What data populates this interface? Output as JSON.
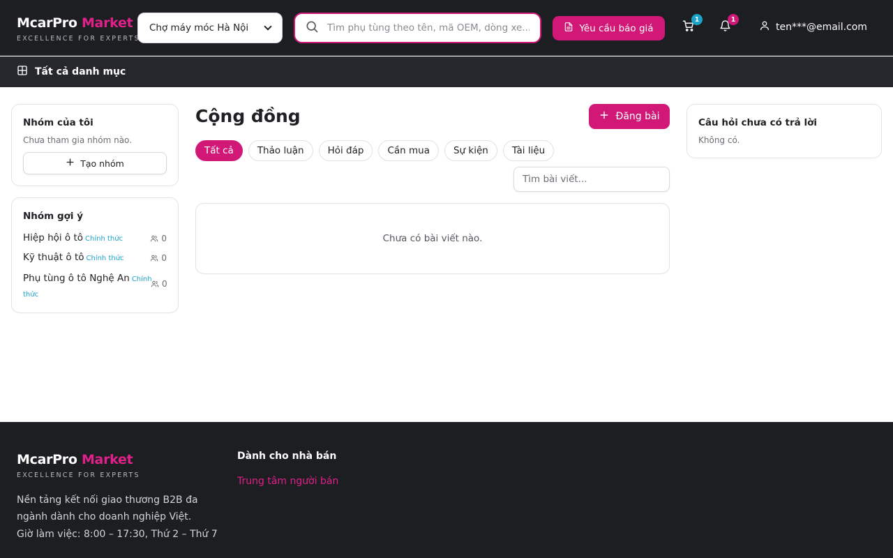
{
  "header": {
    "logo_main": "McarPro",
    "logo_accent": "Market",
    "tagline": "EXCELLENCE FOR EXPERTS",
    "market_select": "Chợ máy móc Hà Nội",
    "search_placeholder": "Tìm phụ tùng theo tên, mã OEM, dòng xe...",
    "quote_button": "Yêu cầu báo giá",
    "cart_count": "1",
    "notification_count": "1",
    "user_email": "ten***@email.com"
  },
  "category_bar": {
    "label": "Tất cả danh mục"
  },
  "sidebar": {
    "my_groups": {
      "title": "Nhóm của tôi",
      "empty": "Chưa tham gia nhóm nào.",
      "create_button": "Tạo nhóm"
    },
    "suggested": {
      "title": "Nhóm gợi ý",
      "groups": [
        {
          "name": "Hiệp hội ô tô",
          "tag": "Chính thức",
          "members": "0"
        },
        {
          "name": "Kỹ thuật ô tô",
          "tag": "Chính thức",
          "members": "0"
        },
        {
          "name": "Phụ tùng ô tô Nghệ An",
          "tag": "Chính thức",
          "members": "0"
        }
      ]
    }
  },
  "main": {
    "title": "Cộng đồng",
    "post_button": "Đăng bài",
    "filters": [
      "Tất cả",
      "Thảo luận",
      "Hỏi đáp",
      "Cần mua",
      "Sự kiện",
      "Tài liệu"
    ],
    "active_filter": "Tất cả",
    "post_search_placeholder": "Tìm bài viết...",
    "empty_text": "Chưa có bài viết nào."
  },
  "right": {
    "unanswered_title": "Câu hỏi chưa có trả lời",
    "unanswered_empty": "Không có."
  },
  "footer": {
    "logo_main": "McarPro",
    "logo_accent": "Market",
    "tagline": "EXCELLENCE FOR EXPERTS",
    "description": "Nền tảng kết nối giao thương B2B đa ngành dành cho doanh nghiệp Việt.",
    "hours": "Giờ làm việc: 8:00 – 17:30, Thứ 2 – Thứ 7",
    "seller_title": "Dành cho nhà bán",
    "seller_link": "Trung tâm người bán"
  },
  "colors": {
    "brand": "#d11877",
    "accent_text": "#e0218a",
    "cart_badge": "#1aa3c9",
    "dark_bg": "#1d1e22"
  },
  "icons": [
    "search-icon",
    "document-icon",
    "cart-icon",
    "bell-icon",
    "user-icon",
    "grid-icon",
    "plus-icon",
    "members-icon"
  ]
}
